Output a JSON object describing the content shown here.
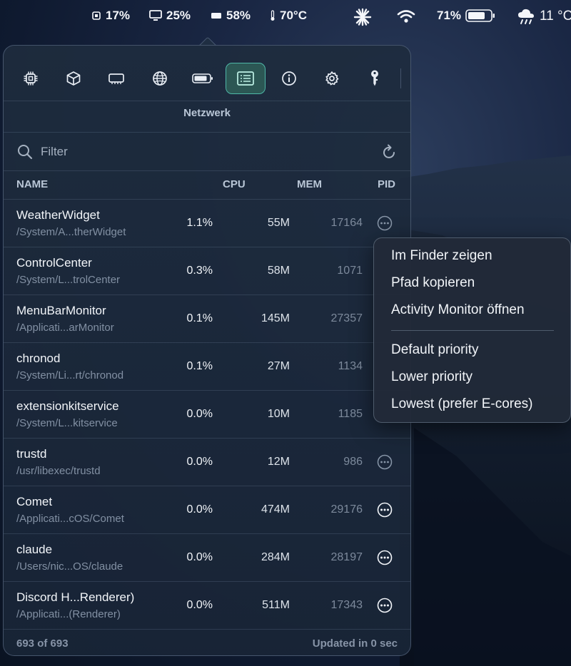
{
  "menubar": {
    "cpu": "17%",
    "gpu": "25%",
    "memory": "58%",
    "temperature": "70°C",
    "battery": "71%",
    "weather": "11 °C"
  },
  "toolbar": {
    "active_tab": "Netzwerk",
    "tab_icons": [
      "cpu-icon",
      "cube-icon",
      "memory-icon",
      "globe-icon",
      "battery-icon",
      "process-list-icon",
      "info-icon",
      "gear-icon",
      "key-icon"
    ]
  },
  "section_title": "Netzwerk",
  "search": {
    "placeholder": "Filter"
  },
  "columns": {
    "name": "NAME",
    "cpu": "CPU",
    "mem": "MEM",
    "pid": "PID"
  },
  "processes": [
    {
      "name": "WeatherWidget",
      "path": "/System/A...therWidget",
      "cpu": "1.1%",
      "mem": "55M",
      "pid": "17164",
      "more": "dim"
    },
    {
      "name": "ControlCenter",
      "path": "/System/L...trolCenter",
      "cpu": "0.3%",
      "mem": "58M",
      "pid": "1071",
      "more": "none"
    },
    {
      "name": "MenuBarMonitor",
      "path": "/Applicati...arMonitor",
      "cpu": "0.1%",
      "mem": "145M",
      "pid": "27357",
      "more": "none"
    },
    {
      "name": "chronod",
      "path": "/System/Li...rt/chronod",
      "cpu": "0.1%",
      "mem": "27M",
      "pid": "1134",
      "more": "none"
    },
    {
      "name": "extensionkitservice",
      "path": "/System/L...kitservice",
      "cpu": "0.0%",
      "mem": "10M",
      "pid": "1185",
      "more": "none"
    },
    {
      "name": "trustd",
      "path": "/usr/libexec/trustd",
      "cpu": "0.0%",
      "mem": "12M",
      "pid": "986",
      "more": "dim"
    },
    {
      "name": "Comet",
      "path": "/Applicati...cOS/Comet",
      "cpu": "0.0%",
      "mem": "474M",
      "pid": "29176",
      "more": "bright"
    },
    {
      "name": "claude",
      "path": "/Users/nic...OS/claude",
      "cpu": "0.0%",
      "mem": "284M",
      "pid": "28197",
      "more": "bright"
    },
    {
      "name": "Discord H...Renderer)",
      "path": "/Applicati...(Renderer)",
      "cpu": "0.0%",
      "mem": "511M",
      "pid": "17343",
      "more": "bright"
    }
  ],
  "footer": {
    "count": "693 of 693",
    "updated": "Updated in 0 sec"
  },
  "context_menu": {
    "items": [
      "Im Finder zeigen",
      "Pfad kopieren",
      "Activity Monitor öffnen"
    ],
    "priority_items": [
      "Default priority",
      "Lower priority",
      "Lowest (prefer E-cores)"
    ]
  },
  "colors": {
    "accent": "#4fb8a8",
    "active_tab_bg": "#2c5754"
  }
}
